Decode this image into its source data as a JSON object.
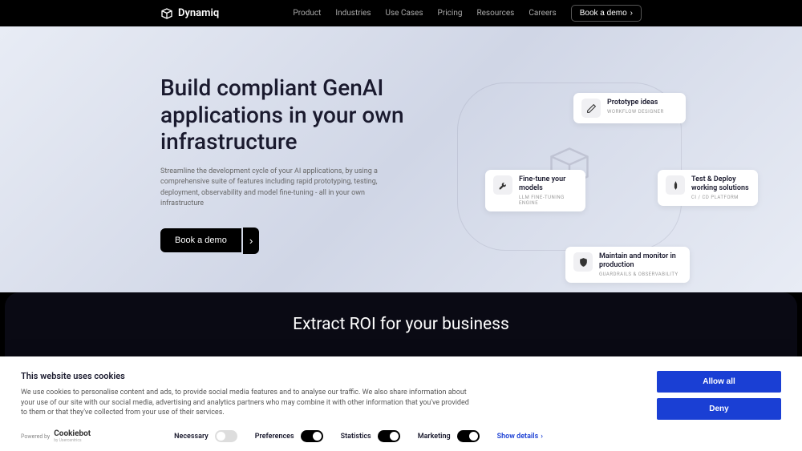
{
  "brand": "Dynamiq",
  "nav": {
    "items": [
      "Product",
      "Industries",
      "Use Cases",
      "Pricing",
      "Resources",
      "Careers"
    ],
    "cta": "Book a demo"
  },
  "hero": {
    "title": "Build compliant GenAI applications in your own infrastructure",
    "subtitle": "Streamline the development cycle of your AI applications, by using a comprehensive suite of features including rapid prototyping, testing, deployment, observability and model fine-tuning - all in your own infrastructure",
    "cta": "Book a demo"
  },
  "cards": [
    {
      "title": "Prototype ideas",
      "sub": "WORKFLOW DESIGNER"
    },
    {
      "title": "Fine-tune your models",
      "sub": "LLM FINE-TUNING ENGINE"
    },
    {
      "title": "Test & Deploy working solutions",
      "sub": "CI / CD PLATFORM"
    },
    {
      "title": "Maintain and monitor in production",
      "sub": "GUARDRAILS & OBSERVABILITY"
    }
  ],
  "section2": {
    "title": "Extract ROI for your business"
  },
  "cookie": {
    "title": "This website uses cookies",
    "desc": "We use cookies to personalise content and ads, to provide social media features and to analyse our traffic. We also share information about your use of our site with our social media, advertising and analytics partners who may combine it with other information that you've provided to them or that they've collected from your use of their services.",
    "allow": "Allow all",
    "deny": "Deny",
    "powered": "Powered by",
    "cookiebot": "Cookiebot",
    "cookiebot_sub": "by Usercentrics",
    "toggles": [
      {
        "label": "Necessary",
        "on": false
      },
      {
        "label": "Preferences",
        "on": true
      },
      {
        "label": "Statistics",
        "on": true
      },
      {
        "label": "Marketing",
        "on": true
      }
    ],
    "details": "Show details"
  }
}
